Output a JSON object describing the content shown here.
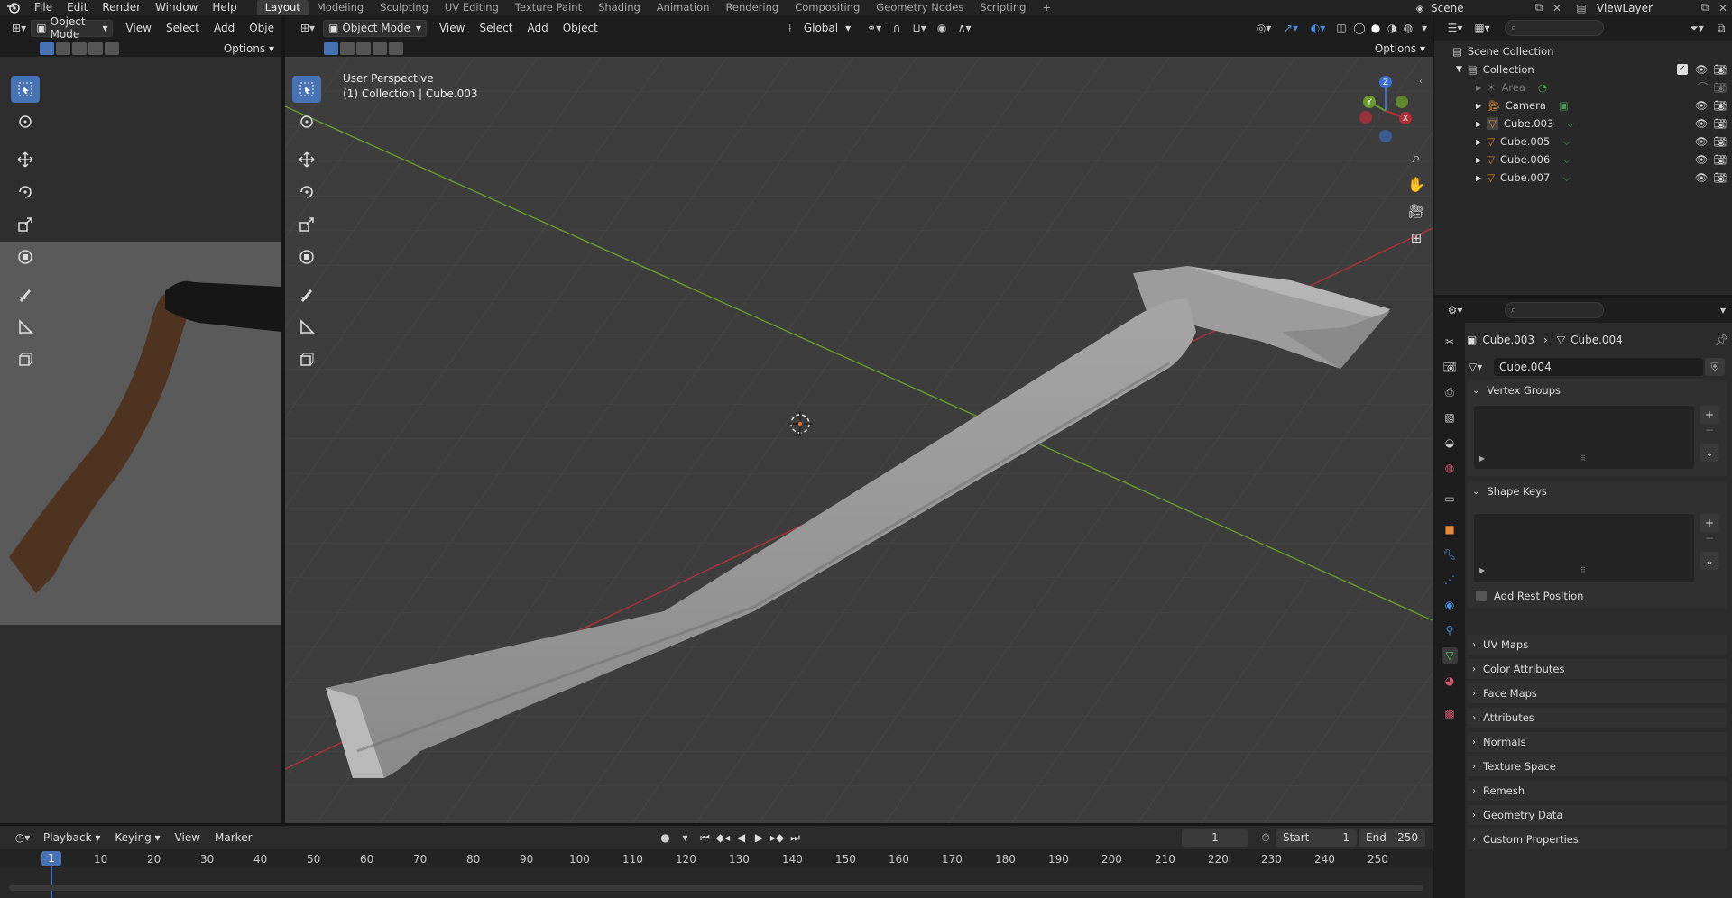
{
  "top_menu": [
    "File",
    "Edit",
    "Render",
    "Window",
    "Help"
  ],
  "workspace_tabs": [
    "Layout",
    "Modeling",
    "Sculpting",
    "UV Editing",
    "Texture Paint",
    "Shading",
    "Animation",
    "Rendering",
    "Compositing",
    "Geometry Nodes",
    "Scripting"
  ],
  "active_workspace": "Layout",
  "scene_name": "Scene",
  "view_layer": "ViewLayer",
  "left_view": {
    "mode": "Object Mode",
    "menus": [
      "View",
      "Select",
      "Add",
      "Obje"
    ],
    "options": "Options"
  },
  "main_view": {
    "mode": "Object Mode",
    "menus": [
      "View",
      "Select",
      "Add",
      "Object"
    ],
    "transform_orientation": "Global",
    "options": "Options",
    "overlay_title": "User Perspective",
    "overlay_subtitle": "(1) Collection | Cube.003",
    "gizmo_axes": {
      "x": "X",
      "y": "Y",
      "z": "Z"
    }
  },
  "outliner": {
    "root": "Scene Collection",
    "collection": "Collection",
    "items": [
      "Area",
      "Camera",
      "Cube.003",
      "Cube.005",
      "Cube.006",
      "Cube.007"
    ]
  },
  "properties": {
    "breadcrumb_object": "Cube.003",
    "breadcrumb_mesh": "Cube.004",
    "mesh_name": "Cube.004",
    "panels_open": [
      "Vertex Groups",
      "Shape Keys"
    ],
    "add_rest_position": "Add Rest Position",
    "panels_closed": [
      "UV Maps",
      "Color Attributes",
      "Face Maps",
      "Attributes",
      "Normals",
      "Texture Space",
      "Remesh",
      "Geometry Data",
      "Custom Properties"
    ]
  },
  "timeline": {
    "menus": [
      "Playback",
      "Keying",
      "View",
      "Marker"
    ],
    "current_frame": "1",
    "start_label": "Start",
    "start_value": "1",
    "end_label": "End",
    "end_value": "250",
    "ruler_marks": [
      "10",
      "20",
      "30",
      "40",
      "50",
      "60",
      "70",
      "80",
      "90",
      "100",
      "110",
      "120",
      "130",
      "140",
      "150",
      "160",
      "170",
      "180",
      "190",
      "200",
      "210",
      "220",
      "230",
      "240",
      "250"
    ],
    "playhead": "1"
  },
  "colors": {
    "accent": "#4772b3",
    "x_axis": "#b0303a",
    "y_axis": "#6a9a2a",
    "z_axis": "#3a6fd0",
    "viewport_bg": "#3d3d3d"
  }
}
